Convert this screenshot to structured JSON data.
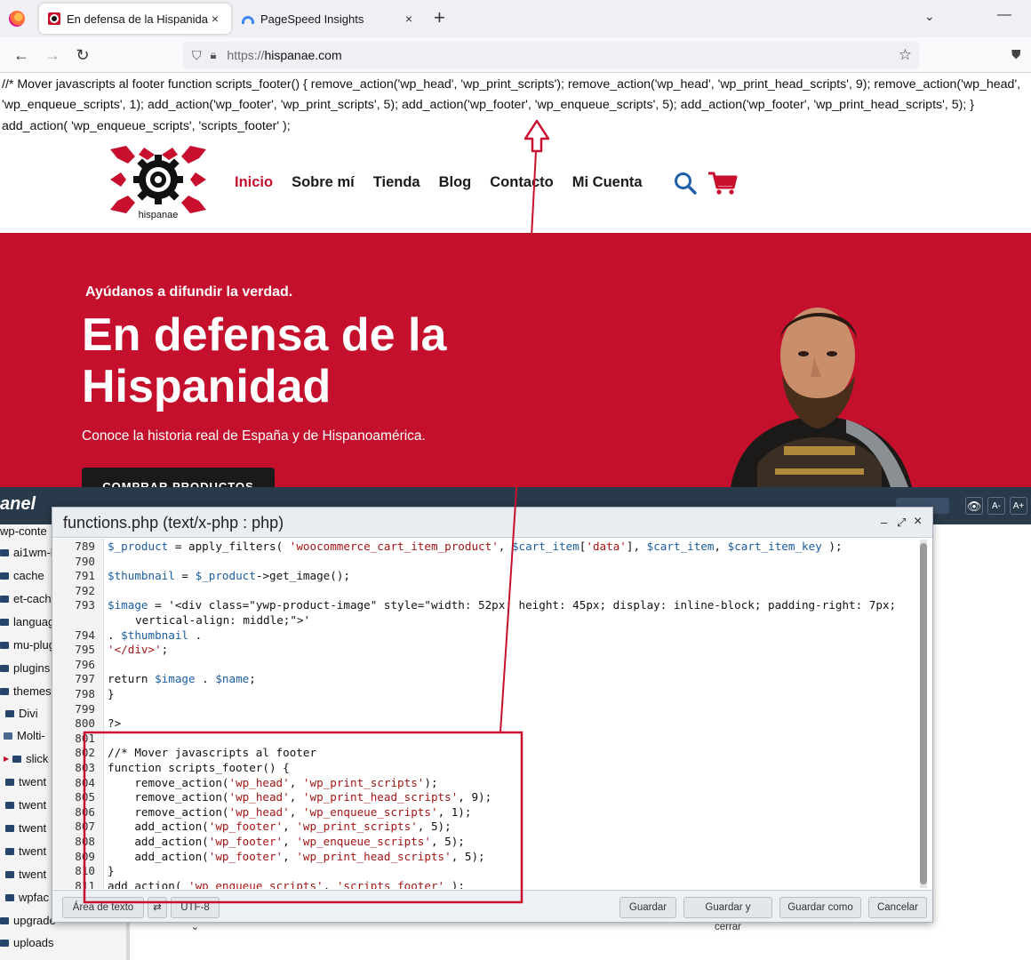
{
  "browser": {
    "tabs": [
      {
        "label": "En defensa de la Hispanidad",
        "close": "×"
      },
      {
        "label": "PageSpeed Insights",
        "close": "×"
      }
    ],
    "new_tab": "+",
    "url_scheme": "https://",
    "url_host": "hispanae.com"
  },
  "page": {
    "php_text": "//* Mover javascripts al footer function scripts_footer() { remove_action('wp_head', 'wp_print_scripts'); remove_action('wp_head', 'wp_print_head_scripts', 9); remove_action('wp_head', 'wp_enqueue_scripts', 1); add_action('wp_footer', 'wp_print_scripts', 5); add_action('wp_footer', 'wp_enqueue_scripts', 5); add_action('wp_footer', 'wp_print_head_scripts', 5); } add_action( 'wp_enqueue_scripts', 'scripts_footer' );",
    "logo_text": "hispanae",
    "nav": [
      "Inicio",
      "Sobre mí",
      "Tienda",
      "Blog",
      "Contacto",
      "Mi Cuenta"
    ],
    "hero": {
      "kicker": "Ayúdanos a difundir la verdad.",
      "title": "En defensa de la Hispanidad",
      "subtitle": "Conoce la historia real de España y de Hispanoamérica.",
      "button": "COMPRAR PRODUCTOS"
    }
  },
  "cpanel": {
    "brand": "anel",
    "font_buttons": [
      "A-",
      "A+"
    ],
    "tree": [
      {
        "label": "wp-conte",
        "kind": "folder"
      },
      {
        "label": "ai1wm-b",
        "kind": "folder"
      },
      {
        "label": "cache",
        "kind": "folder"
      },
      {
        "label": "et-cach",
        "kind": "folder"
      },
      {
        "label": "languag",
        "kind": "folder"
      },
      {
        "label": "mu-plug",
        "kind": "folder"
      },
      {
        "label": "plugins",
        "kind": "folder"
      },
      {
        "label": "themes",
        "kind": "folder"
      },
      {
        "label": "Divi",
        "kind": "folder"
      },
      {
        "label": "Molti-",
        "kind": "open"
      },
      {
        "label": "slick",
        "kind": "caret"
      },
      {
        "label": "twent",
        "kind": "folder"
      },
      {
        "label": "twent",
        "kind": "folder"
      },
      {
        "label": "twent",
        "kind": "folder"
      },
      {
        "label": "twent",
        "kind": "folder"
      },
      {
        "label": "twent",
        "kind": "folder"
      },
      {
        "label": "wpfac",
        "kind": "folder"
      },
      {
        "label": "upgrade",
        "kind": "folder"
      },
      {
        "label": "uploads",
        "kind": "folder"
      }
    ]
  },
  "editor": {
    "title": "functions.php (text/x-php : php)",
    "controls": [
      "–",
      "⤢",
      "×"
    ],
    "lines": [
      {
        "n": "789",
        "text": "$_product = apply_filters( 'woocommerce_cart_item_product', $cart_item['data'], $cart_item, $cart_item_key );"
      },
      {
        "n": "790",
        "text": ""
      },
      {
        "n": "791",
        "text": "$thumbnail = $_product->get_image();"
      },
      {
        "n": "792",
        "text": ""
      },
      {
        "n": "793",
        "text": "$image = '<div class=\"ywp-product-image\" style=\"width: 52px; height: 45px; display: inline-block; padding-right: 7px;"
      },
      {
        "n": "",
        "text": "vertical-align: middle;\">'",
        "wrap": true
      },
      {
        "n": "794",
        "text": ". $thumbnail ."
      },
      {
        "n": "795",
        "text": "'</div>';"
      },
      {
        "n": "796",
        "text": ""
      },
      {
        "n": "797",
        "text": "return $image . $name;"
      },
      {
        "n": "798",
        "text": "}"
      },
      {
        "n": "799",
        "text": ""
      },
      {
        "n": "800",
        "text": "?>"
      },
      {
        "n": "801",
        "text": ""
      },
      {
        "n": "802",
        "text": "//* Mover javascripts al footer"
      },
      {
        "n": "803",
        "text": "function scripts_footer() {"
      },
      {
        "n": "804",
        "text": "    remove_action('wp_head', 'wp_print_scripts');"
      },
      {
        "n": "805",
        "text": "    remove_action('wp_head', 'wp_print_head_scripts', 9);"
      },
      {
        "n": "806",
        "text": "    remove_action('wp_head', 'wp_enqueue_scripts', 1);"
      },
      {
        "n": "807",
        "text": "    add_action('wp_footer', 'wp_print_scripts', 5);"
      },
      {
        "n": "808",
        "text": "    add_action('wp_footer', 'wp_enqueue_scripts', 5);"
      },
      {
        "n": "809",
        "text": "    add_action('wp_footer', 'wp_print_head_scripts', 5);"
      },
      {
        "n": "810",
        "text": "}"
      },
      {
        "n": "811",
        "text": "add_action( 'wp_enqueue_scripts', 'scripts_footer' );"
      }
    ],
    "footer": {
      "text_area": "Área de texto",
      "wrap_toggle": "⇄",
      "encoding": "UTF-8",
      "save": "Guardar",
      "save_close": "Guardar y cerrar",
      "save_as": "Guardar como",
      "cancel": "Cancelar"
    }
  },
  "colors": {
    "brand_red": "#c5102d",
    "annotation_red": "#c8102e",
    "cpanel_bar": "#293a4a"
  }
}
